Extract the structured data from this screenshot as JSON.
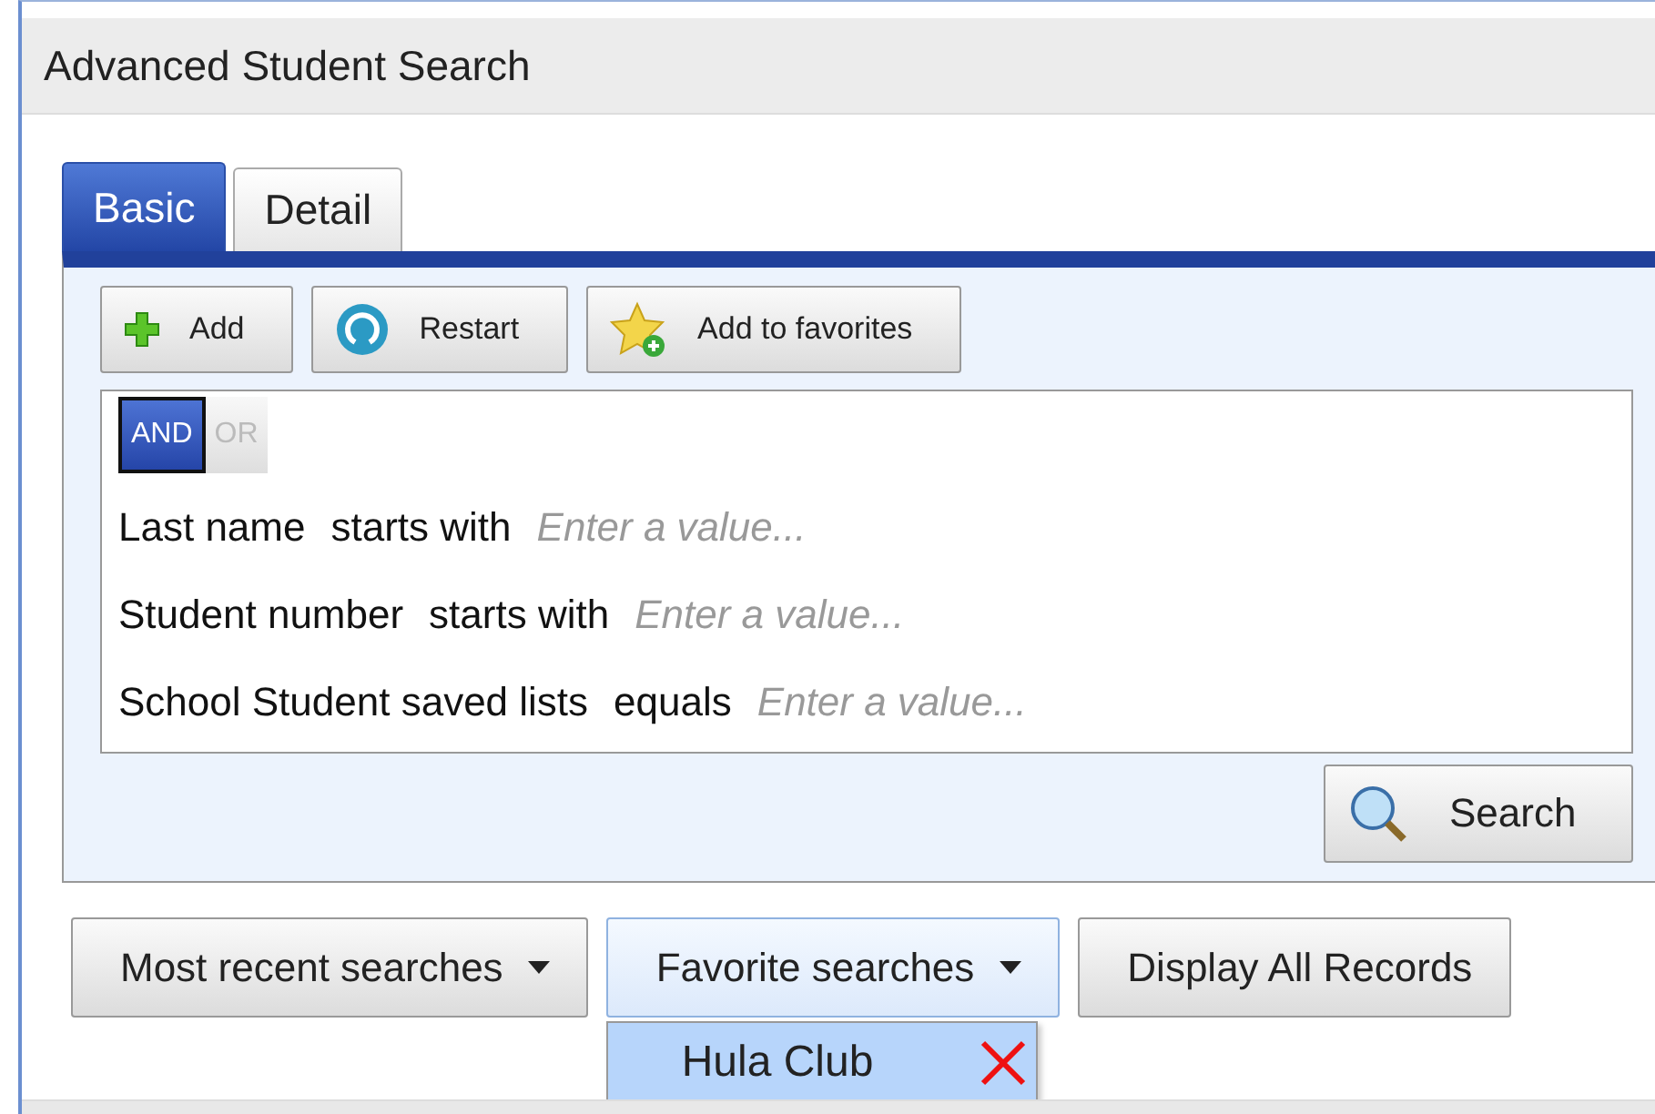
{
  "window": {
    "title": "Advanced Student Search"
  },
  "tabs": [
    {
      "label": "Basic",
      "selected": true
    },
    {
      "label": "Detail",
      "selected": false
    }
  ],
  "toolbar": [
    {
      "label": "Add",
      "kind": "plus"
    },
    {
      "label": "Restart",
      "kind": "restart"
    },
    {
      "label": "Add to favorites",
      "kind": "star"
    }
  ],
  "logic": [
    {
      "label": "AND",
      "selected": true
    },
    {
      "label": "OR",
      "selected": false
    }
  ],
  "criteria": [
    {
      "field": "Last name",
      "operator": "starts with",
      "placeholder": "Enter a value..."
    },
    {
      "field": "Student number",
      "operator": "starts with",
      "placeholder": "Enter a value..."
    },
    {
      "field": "School Student saved lists",
      "operator": "equals",
      "placeholder": "Enter a value..."
    }
  ],
  "search_button": "Search",
  "bottom_buttons": [
    {
      "label": "Most recent searches",
      "dropdown": true,
      "open": false
    },
    {
      "label": "Favorite searches",
      "dropdown": true,
      "open": true
    },
    {
      "label": "Display All Records",
      "dropdown": false,
      "open": false
    }
  ],
  "favorites_menu": [
    {
      "label": "Hula Club",
      "selected": true
    }
  ]
}
